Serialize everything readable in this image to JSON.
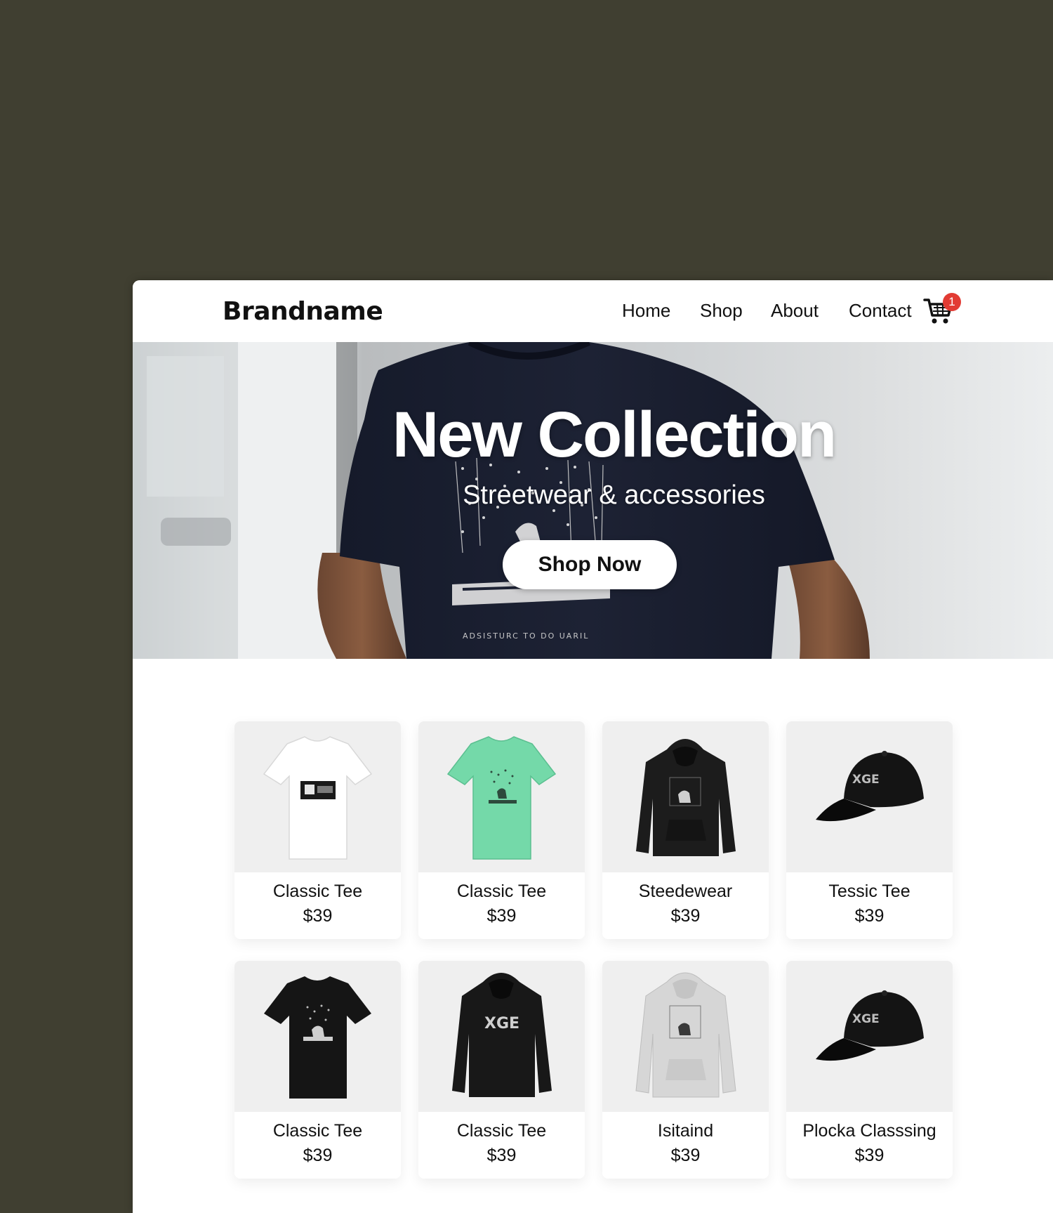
{
  "brand": "Brandname",
  "nav": {
    "links": [
      "Home",
      "Shop",
      "About",
      "Contact"
    ],
    "cart_icon": "shopping-cart-icon",
    "cart_count": "1"
  },
  "hero": {
    "title": "New Collection",
    "subtitle": "Streetwear & accessories",
    "cta": "Shop Now",
    "shirt_print_text": "ADSISTURC TO DO UARIL"
  },
  "products": [
    {
      "name": "Classic Tee",
      "price": "$39",
      "type": "t-shirt",
      "color": "#ffffff"
    },
    {
      "name": "Classic Tee",
      "price": "$39",
      "type": "t-shirt",
      "color": "#74d9a9"
    },
    {
      "name": "Steedewear",
      "price": "$39",
      "type": "hoodie",
      "color": "#1c1c1c"
    },
    {
      "name": "Tessic Tee",
      "price": "$39",
      "type": "cap",
      "color": "#141414"
    },
    {
      "name": "Classic Tee",
      "price": "$39",
      "type": "t-shirt",
      "color": "#151515"
    },
    {
      "name": "Classic Tee",
      "price": "$39",
      "type": "hoodie",
      "color": "#181818"
    },
    {
      "name": "Isitaind",
      "price": "$39",
      "type": "hoodie",
      "color": "#d6d6d6"
    },
    {
      "name": "Plocka Classsing",
      "price": "$39",
      "type": "cap",
      "color": "#141414"
    }
  ],
  "colors": {
    "backdrop": "#403f31",
    "badge": "#e23b33",
    "text": "#111111"
  }
}
